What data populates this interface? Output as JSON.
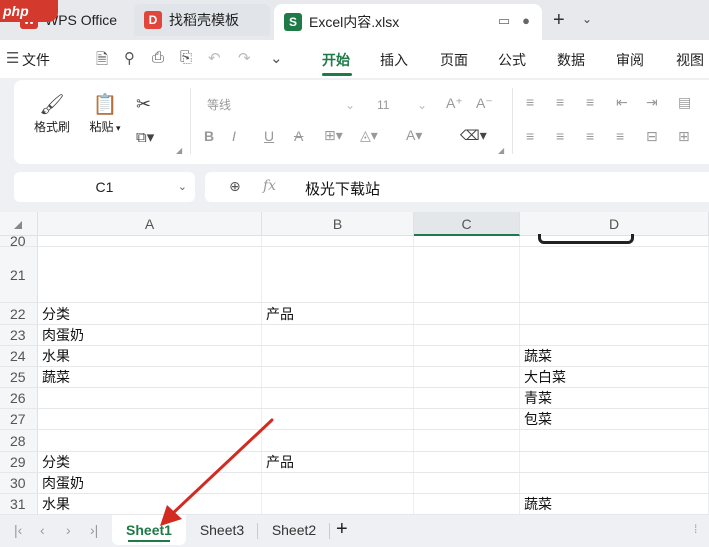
{
  "titlebar": {
    "logo_text": "php",
    "tabs": [
      {
        "label": "WPS Office",
        "icon": "wps-icon"
      },
      {
        "label": "找稻壳模板",
        "icon": "docer-icon"
      },
      {
        "label": "Excel内容.xlsx",
        "icon": "excel-icon"
      }
    ],
    "new_tab": "+"
  },
  "menu": {
    "file": "文件",
    "items": [
      "开始",
      "插入",
      "页面",
      "公式",
      "数据",
      "审阅",
      "视图"
    ],
    "active": "开始"
  },
  "ribbon": {
    "format_painter": "格式刷",
    "paste": "粘贴",
    "font_name": "等线",
    "font_size": "11"
  },
  "formula_bar": {
    "cell_ref": "C1",
    "fx": "fx",
    "value": "极光下载站"
  },
  "grid": {
    "columns": [
      "A",
      "B",
      "C",
      "D"
    ],
    "rows": [
      {
        "num": "20",
        "A": "",
        "B": "",
        "D": ""
      },
      {
        "num": "21",
        "A": "",
        "B": "",
        "D": ""
      },
      {
        "num": "22",
        "A": "分类",
        "B": "产品",
        "D": ""
      },
      {
        "num": "23",
        "A": "肉蛋奶",
        "B": "",
        "D": ""
      },
      {
        "num": "24",
        "A": "水果",
        "B": "",
        "D": "蔬菜"
      },
      {
        "num": "25",
        "A": "蔬菜",
        "B": "",
        "D": "大白菜"
      },
      {
        "num": "26",
        "A": "",
        "B": "",
        "D": "青菜"
      },
      {
        "num": "27",
        "A": "",
        "B": "",
        "D": "包菜"
      },
      {
        "num": "28",
        "A": "",
        "B": "",
        "D": ""
      },
      {
        "num": "29",
        "A": "分类",
        "B": "产品",
        "D": ""
      },
      {
        "num": "30",
        "A": "肉蛋奶",
        "B": "",
        "D": ""
      },
      {
        "num": "31",
        "A": "水果",
        "B": "",
        "D": "蔬菜"
      }
    ]
  },
  "sheets": {
    "tabs": [
      "Sheet1",
      "Sheet3",
      "Sheet2"
    ],
    "active": "Sheet1",
    "add": "+"
  },
  "colors": {
    "accent": "#1e7a47",
    "annotation_arrow": "#d22b22"
  }
}
